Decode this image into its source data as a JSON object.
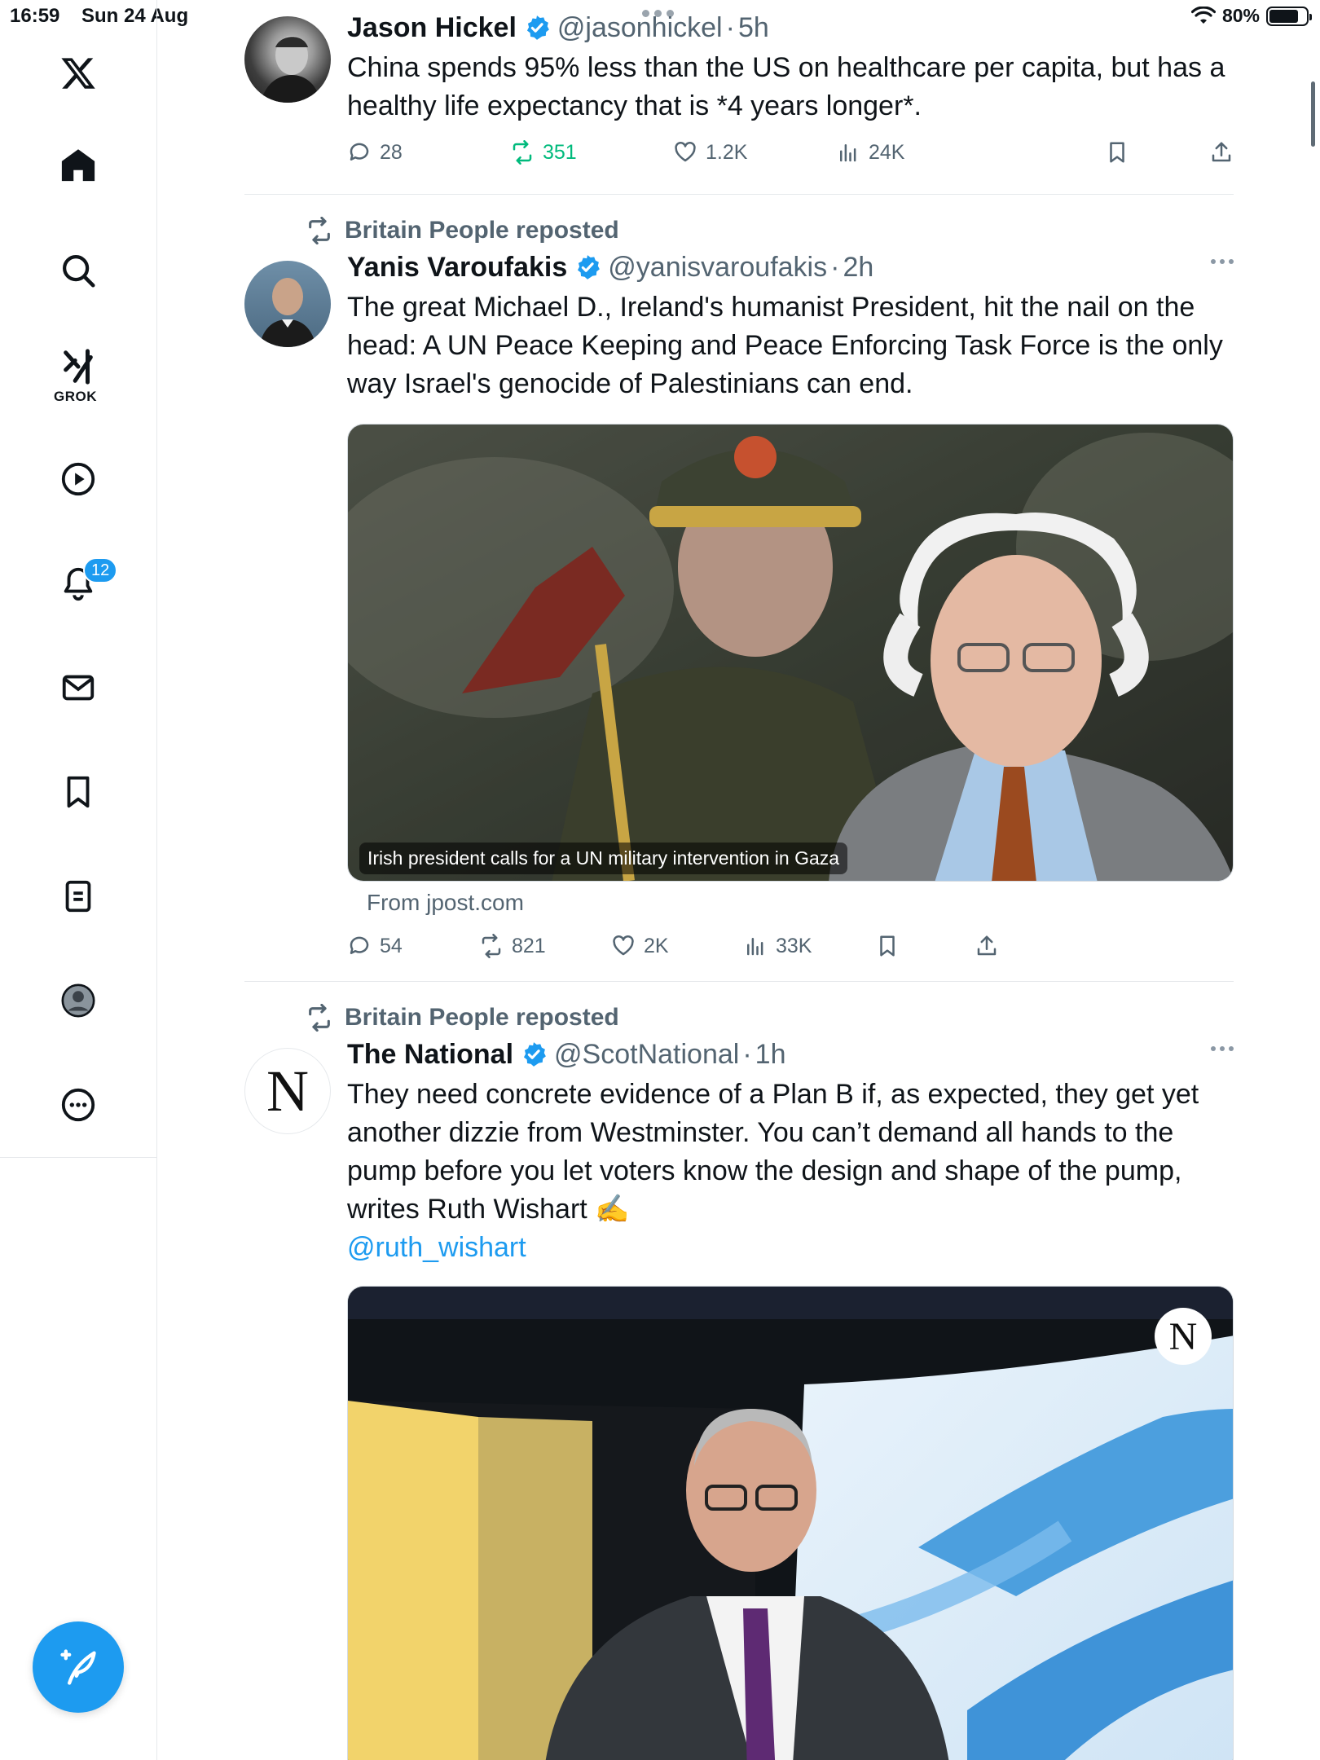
{
  "status_bar": {
    "time": "16:59",
    "date": "Sun 24 Aug",
    "battery": "80%",
    "battery_level": 0.8
  },
  "sidebar": {
    "items": [
      {
        "name": "x-logo",
        "icon": "x-logo-icon"
      },
      {
        "name": "home",
        "icon": "home-icon"
      },
      {
        "name": "search",
        "icon": "search-icon"
      },
      {
        "name": "grok",
        "icon": "grok-icon",
        "label": "GROK"
      },
      {
        "name": "videos",
        "icon": "play-icon"
      },
      {
        "name": "notifications",
        "icon": "bell-icon",
        "badge": "12"
      },
      {
        "name": "messages",
        "icon": "mail-icon"
      },
      {
        "name": "bookmarks",
        "icon": "bookmark-icon"
      },
      {
        "name": "lists",
        "icon": "list-icon"
      },
      {
        "name": "profile",
        "icon": "profile-icon"
      },
      {
        "name": "more",
        "icon": "more-icon"
      }
    ],
    "compose_icon": "compose-icon"
  },
  "colors": {
    "accent": "#1d9bf0",
    "text": "#0f1419",
    "muted": "#536471",
    "repost_active": "#00ba7c"
  },
  "tweets": [
    {
      "name": "Jason Hickel",
      "handle": "@jasonhickel",
      "separator": "·",
      "time": "5h",
      "text": "China spends 95% less than the US on healthcare per capita, but has a healthy life expectancy that is *4 years longer*.",
      "replies": "28",
      "reposts": "351",
      "likes": "1.2K",
      "views": "24K"
    },
    {
      "reposted_by": "Britain People reposted",
      "name": "Yanis Varoufakis",
      "handle": "@yanisvaroufakis",
      "separator": "·",
      "time": "2h",
      "text": "The great Michael D., Ireland's humanist President, hit the nail on the head: A UN Peace Keeping and Peace Enforcing Task Force is the only way Israel's genocide of Palestinians can end.",
      "card_caption": "Irish president calls for a UN military intervention in Gaza",
      "card_source": "From jpost.com",
      "replies": "54",
      "reposts": "821",
      "likes": "2K",
      "views": "33K"
    },
    {
      "reposted_by": "Britain People reposted",
      "name": "The National",
      "handle": "@ScotNational",
      "separator": "·",
      "time": "1h",
      "avatar_letter": "N",
      "text": "They need concrete evidence of a Plan B if, as expected, they get yet another dizzie from Westminster. You can’t demand all hands to the pump before you let voters know the design and shape of the pump, writes Ruth Wishart ✍️",
      "mention": "@ruth_wishart",
      "media_logo_letter": "N"
    }
  ]
}
